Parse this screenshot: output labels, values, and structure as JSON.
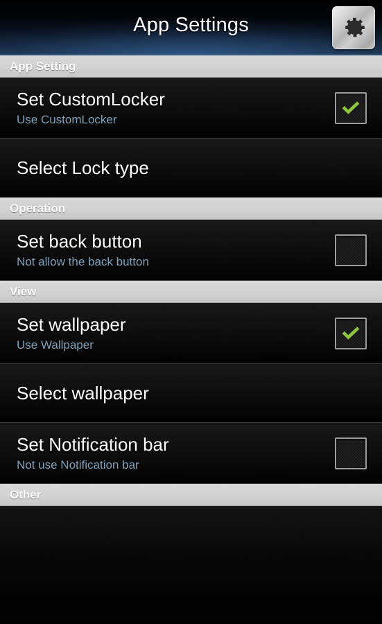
{
  "titlebar": {
    "title": "App Settings",
    "gear_icon": "gear-icon"
  },
  "colors": {
    "accent_check": "#8dc63f",
    "subtitle": "#7fa2bd",
    "section_header_bg": "#d2d2d2",
    "row_bg": "#0d0d0d",
    "title_bar_blue": "#2b4a6b"
  },
  "sections": [
    {
      "header": "App Setting",
      "rows": [
        {
          "title": "Set CustomLocker",
          "subtitle": "Use CustomLocker",
          "checkbox": "checked"
        },
        {
          "title": "Select Lock type",
          "subtitle": "",
          "checkbox": "none"
        }
      ]
    },
    {
      "header": "Operation",
      "rows": [
        {
          "title": "Set back button",
          "subtitle": "Not allow the back button",
          "checkbox": "unchecked"
        }
      ]
    },
    {
      "header": "View",
      "rows": [
        {
          "title": "Set wallpaper",
          "subtitle": "Use Wallpaper",
          "checkbox": "checked"
        },
        {
          "title": "Select wallpaper",
          "subtitle": "",
          "checkbox": "none"
        },
        {
          "title": "Set Notification bar",
          "subtitle": "Not use Notification bar",
          "checkbox": "unchecked"
        }
      ]
    },
    {
      "header": "Other",
      "rows": []
    }
  ]
}
